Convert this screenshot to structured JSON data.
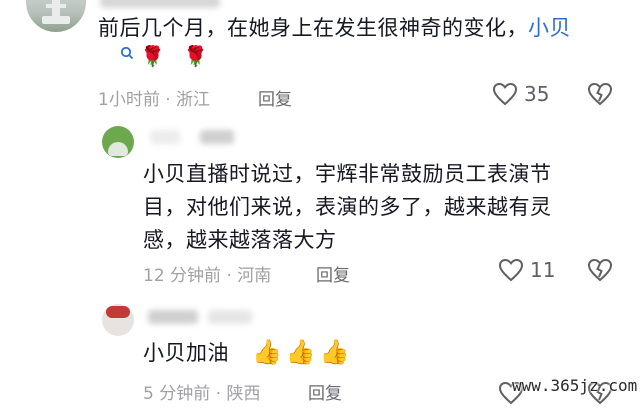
{
  "comments": [
    {
      "text": "前后几个月，在她身上在发生很神奇的变化，",
      "mention": "小贝",
      "emoji": "🌹 🌹",
      "time": "1小时前",
      "location": "浙江",
      "reply_label": "回复",
      "like_count": "35"
    },
    {
      "text_line1": "小贝直播时说过，宇辉非常鼓励员工表演节",
      "text_line2": "目，对他们来说，表演的多了，越来越有灵",
      "text_line3": "感，越来越落落大方",
      "time": "12 分钟前",
      "location": "河南",
      "reply_label": "回复",
      "like_count": "11"
    },
    {
      "text": "小贝加油",
      "emoji": "👍👍👍",
      "time": "5 分钟前",
      "location": "陕西",
      "reply_label": "回复"
    }
  ],
  "separator": "·",
  "watermark": "www.365jz.com",
  "colors": {
    "mention": "#2c6ed4",
    "meta": "#a0a0a6",
    "text": "#161823"
  },
  "icons": [
    "heart-icon",
    "dislike-heart-icon",
    "search-icon",
    "avatar"
  ]
}
